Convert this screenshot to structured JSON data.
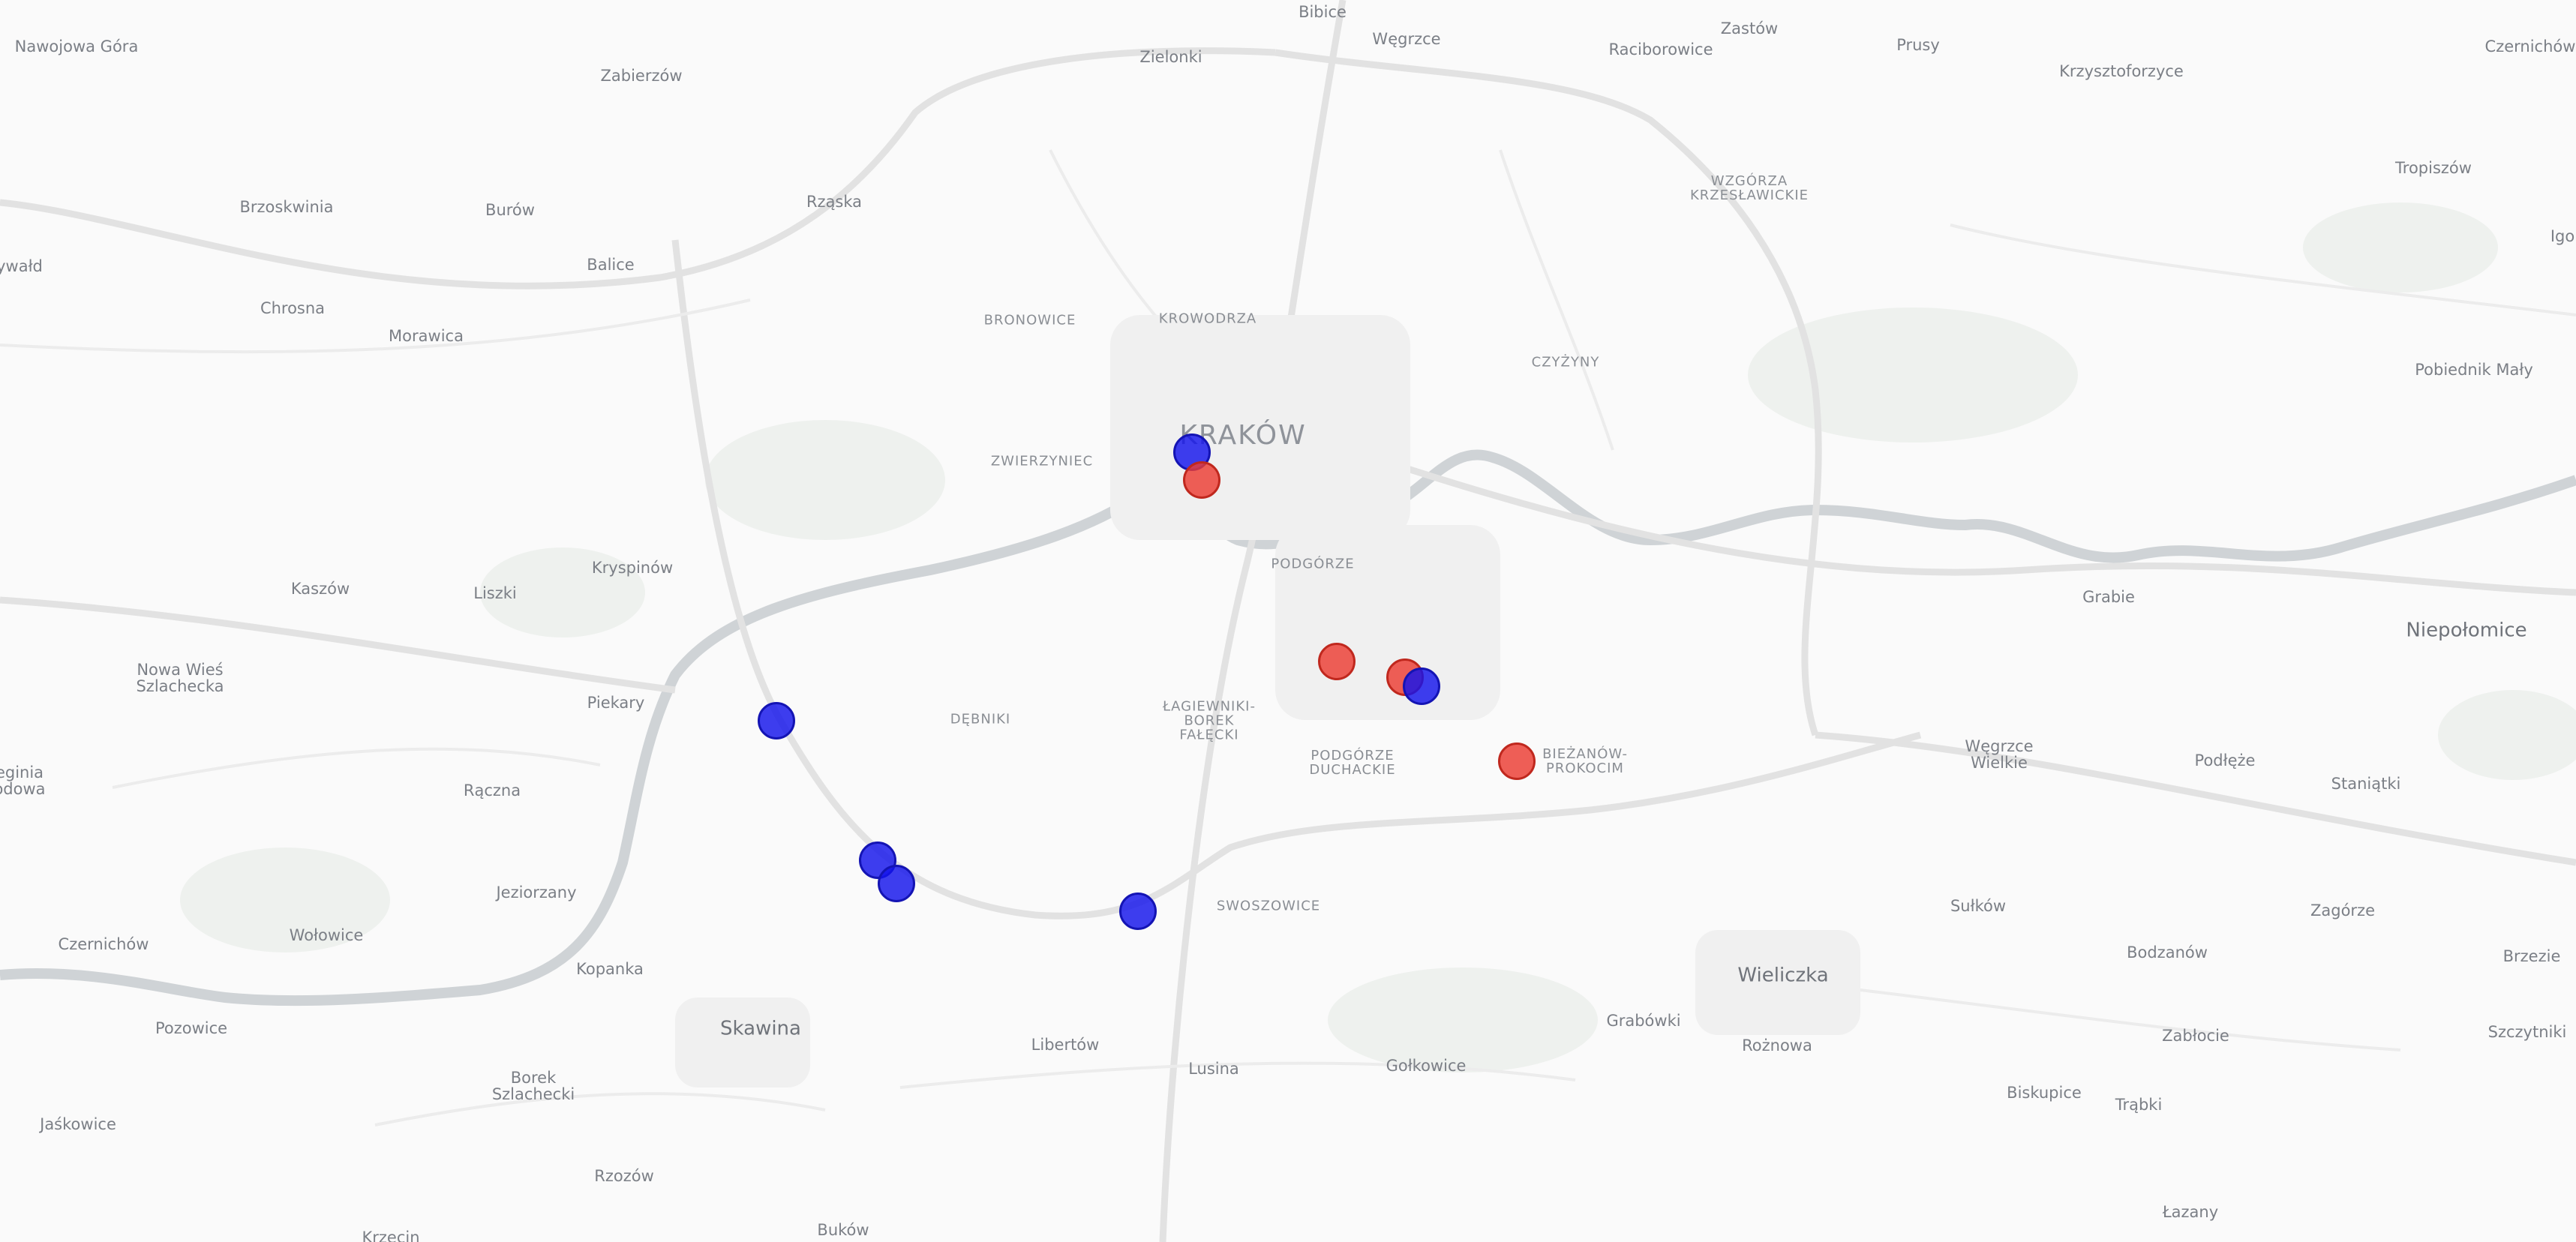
{
  "map": {
    "colors": {
      "background": "#fafafa",
      "road": "#e3e3e3",
      "river": "#cfd3d6",
      "marker_blue": "#1414eb",
      "marker_red": "#eb3c32"
    },
    "labels": {
      "nawojowa_gora": "Nawojowa Góra",
      "zabierzow": "Zabierzów",
      "bibice": "Bibice",
      "wegrzce": "Węgrzce",
      "zielonki": "Zielonki",
      "zastow": "Zastów",
      "raciborowice": "Raciborowice",
      "prusy": "Prusy",
      "krzysztoforzyce": "Krzysztoforzyce",
      "czernichow_ne": "Czernichów",
      "brzoskwinia": "Brzoskwinia",
      "burow": "Burów",
      "rzaska": "Rząska",
      "wzgorza": "WZGÓRZA\nKRZESŁAWICKIE",
      "tropiszow": "Tropiszów",
      "ywald": "ywałd",
      "balice": "Balice",
      "igo": "Igo",
      "chrosna": "Chrosna",
      "morawica": "Morawica",
      "bronowice": "BRONOWICE",
      "krowodrza": "KROWODRZA",
      "czyzyny": "CZYŻYNY",
      "pobiednik_maly": "Pobiednik Mały",
      "krakow": "KRAKÓW",
      "zwierzyniec": "ZWIERZYNIEC",
      "krzypinow": "Kryspinów",
      "podgorze": "PODGÓRZE",
      "kaszow": "Kaszów",
      "liszki": "Liszki",
      "grabie": "Grabie",
      "niepolomice": "Niepołomice",
      "nowa_wies": "Nowa Wieś\nSzlachecka",
      "piekary": "Piekary",
      "debniki": "DĘBNIKI",
      "lagiewniki": "ŁAGIEWNIKI-\nBOREK\nFAŁĘCKI",
      "podgorze_duchackie": "PODGÓRZE\nDUCHACKIE",
      "biezanow": "BIEŻANÓW-\nPROKOCIM",
      "wegrzce_wielkie": "Węgrzce\nWielkie",
      "podleze": "Podłęże",
      "stanialki": "Staniątki",
      "egina": "eginia\nodowa",
      "raczna": "Rączna",
      "jeziorzany": "Jeziorzany",
      "swoszowice": "SWOSZOWICE",
      "sulkow": "Sułków",
      "zagorze": "Zagórze",
      "czernichow_sw": "Czernichów",
      "wolowice": "Wołowice",
      "kopanka": "Kopanka",
      "bodzanow": "Bodzanów",
      "brzezie": "Brzezie",
      "wieliczka": "Wieliczka",
      "pozowice": "Pozowice",
      "skawina": "Skawina",
      "libertow": "Libertów",
      "grabowki": "Grabówki",
      "roznowa": "Rożnowa",
      "zablocie": "Zabłocie",
      "szczytniki": "Szczytniki",
      "lusina": "Lusina",
      "golkowice": "Gołkowice",
      "borek_szlachecki": "Borek\nSzlachecki",
      "biskupice": "Biskupice",
      "trabki": "Trąbki",
      "jaskowice": "Jaśkowice",
      "rzozow": "Rzozów",
      "lazany": "Łazany",
      "bukow": "Buków",
      "krzecin": "Krzęcin"
    },
    "markers": [
      {
        "color": "blue"
      },
      {
        "color": "red"
      },
      {
        "color": "blue"
      },
      {
        "color": "blue"
      },
      {
        "color": "blue"
      },
      {
        "color": "blue"
      },
      {
        "color": "red"
      },
      {
        "color": "red"
      },
      {
        "color": "blue"
      },
      {
        "color": "red"
      }
    ]
  }
}
